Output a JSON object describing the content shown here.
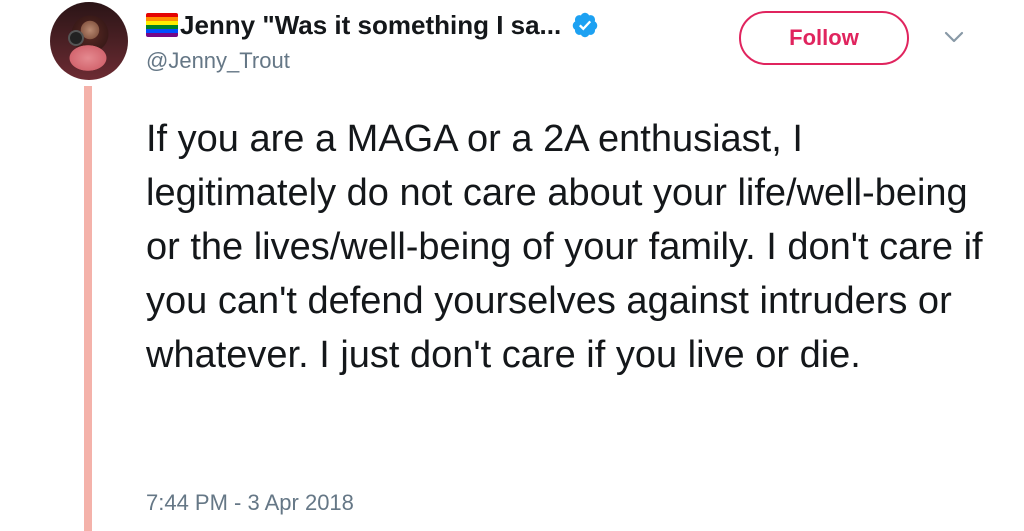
{
  "tweet": {
    "display_name": "Jenny \"Was it something I sa...",
    "handle": "@Jenny_Trout",
    "text": "If you are a MAGA or a 2A enthusiast, I legitimately do not care about your life/well-being or the lives/well-being of your family. I don't care if you can't defend yourselves against intruders or whatever. I just don't care if you live or die.",
    "timestamp": "7:44 PM - 3 Apr 2018",
    "follow_label": "Follow",
    "icons": {
      "flag": "rainbow-flag-icon",
      "verified": "verified-badge-icon",
      "menu": "chevron-down-icon"
    }
  },
  "colors": {
    "follow": "#e0245e",
    "verified": "#1da1f2",
    "thread_line": "#f4b2aa",
    "secondary_text": "#657786",
    "text": "#14171a"
  }
}
